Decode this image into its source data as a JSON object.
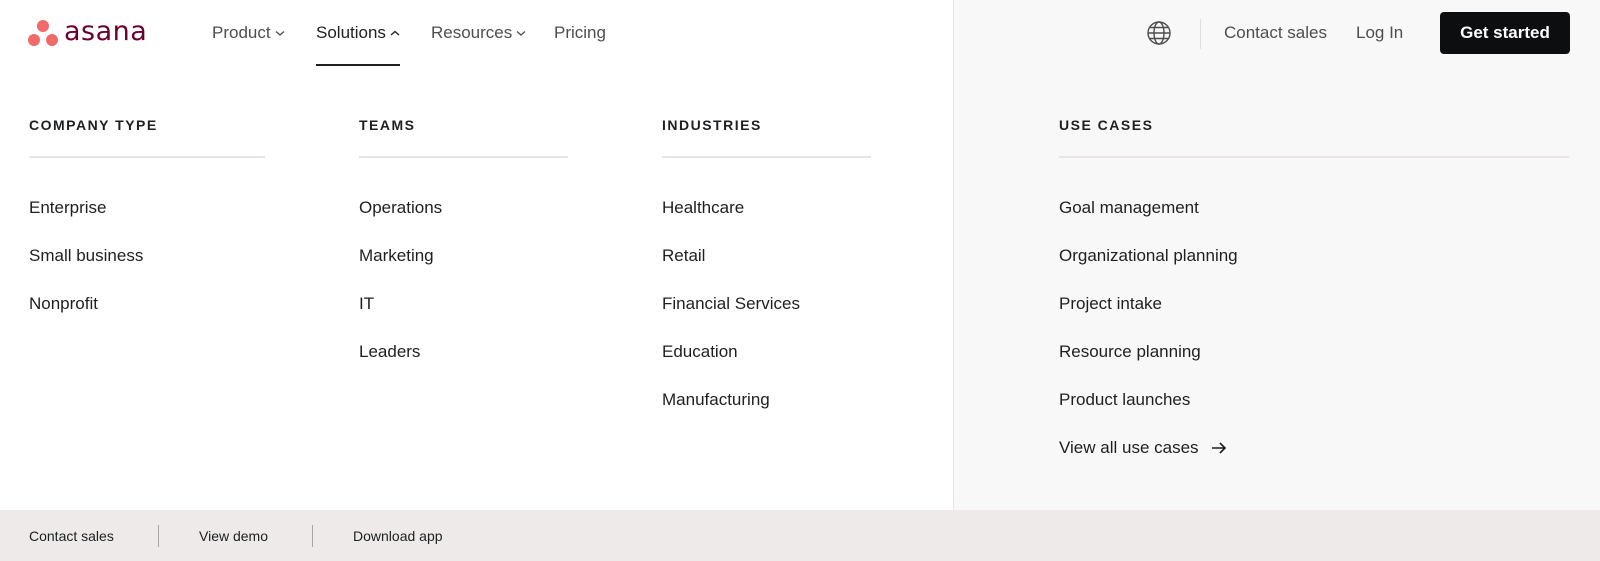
{
  "header": {
    "logo_text": "asana",
    "nav": [
      {
        "label": "Product",
        "chevron": "down"
      },
      {
        "label": "Solutions",
        "chevron": "up"
      },
      {
        "label": "Resources",
        "chevron": "down"
      },
      {
        "label": "Pricing"
      }
    ],
    "globe_icon": "globe-icon",
    "contact_sales": "Contact sales",
    "log_in": "Log In",
    "get_started": "Get started"
  },
  "menu": {
    "company_type": {
      "heading": "COMPANY TYPE",
      "items": [
        "Enterprise",
        "Small business",
        "Nonprofit"
      ]
    },
    "teams": {
      "heading": "TEAMS",
      "items": [
        "Operations",
        "Marketing",
        "IT",
        "Leaders"
      ]
    },
    "industries": {
      "heading": "INDUSTRIES",
      "items": [
        "Healthcare",
        "Retail",
        "Financial Services",
        "Education",
        "Manufacturing"
      ]
    },
    "use_cases": {
      "heading": "USE CASES",
      "items": [
        "Goal management",
        "Organizational planning",
        "Project intake",
        "Resource planning",
        "Product launches"
      ],
      "view_all": "View all use cases"
    }
  },
  "footer": {
    "contact_sales": "Contact sales",
    "view_demo": "View demo",
    "download_app": "Download app"
  },
  "colors": {
    "brand_coral": "#f06a6a",
    "brand_wordmark": "#690031",
    "cta_bg": "#0d0e10",
    "footer_bg": "#edeae9",
    "panel_bg": "#f9f8f8"
  }
}
